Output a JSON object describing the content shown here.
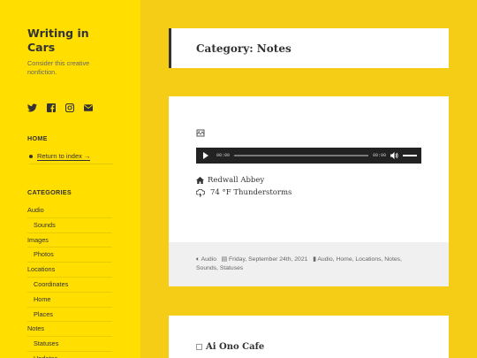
{
  "site": {
    "title": "Writing in Cars",
    "description": "Consider this creative nonfiction."
  },
  "social": [
    {
      "icon": "twitter-icon"
    },
    {
      "icon": "facebook-icon"
    },
    {
      "icon": "instagram-icon"
    },
    {
      "icon": "email-icon"
    }
  ],
  "home_widget": {
    "title": "HOME",
    "link": "Return to index →"
  },
  "categories_widget": {
    "title": "CATEGORIES",
    "items": [
      {
        "label": "Audio",
        "sub": false
      },
      {
        "label": "Sounds",
        "sub": true
      },
      {
        "label": "Images",
        "sub": false
      },
      {
        "label": "Photos",
        "sub": true
      },
      {
        "label": "Locations",
        "sub": false
      },
      {
        "label": "Coordinates",
        "sub": true
      },
      {
        "label": "Home",
        "sub": true
      },
      {
        "label": "Places",
        "sub": true
      },
      {
        "label": "Notes",
        "sub": false
      },
      {
        "label": "Statuses",
        "sub": true
      },
      {
        "label": "Updates",
        "sub": true
      }
    ]
  },
  "archive": {
    "title": "Category: Notes"
  },
  "post": {
    "player": {
      "current": "00:00",
      "duration": "00:00"
    },
    "location": "Redwall Abbey",
    "weather": "74 °F Thunderstorms",
    "footer": {
      "format": "Audio",
      "date": "Friday, September 24th, 2021",
      "categories": "Audio, Home, Locations, Notes, Sounds, Statuses"
    }
  },
  "post2": {
    "title": "Ai Ono Cafe"
  },
  "colors": {
    "page_bg": "#f5cd17",
    "sidebar_bg": "#ffde00"
  }
}
